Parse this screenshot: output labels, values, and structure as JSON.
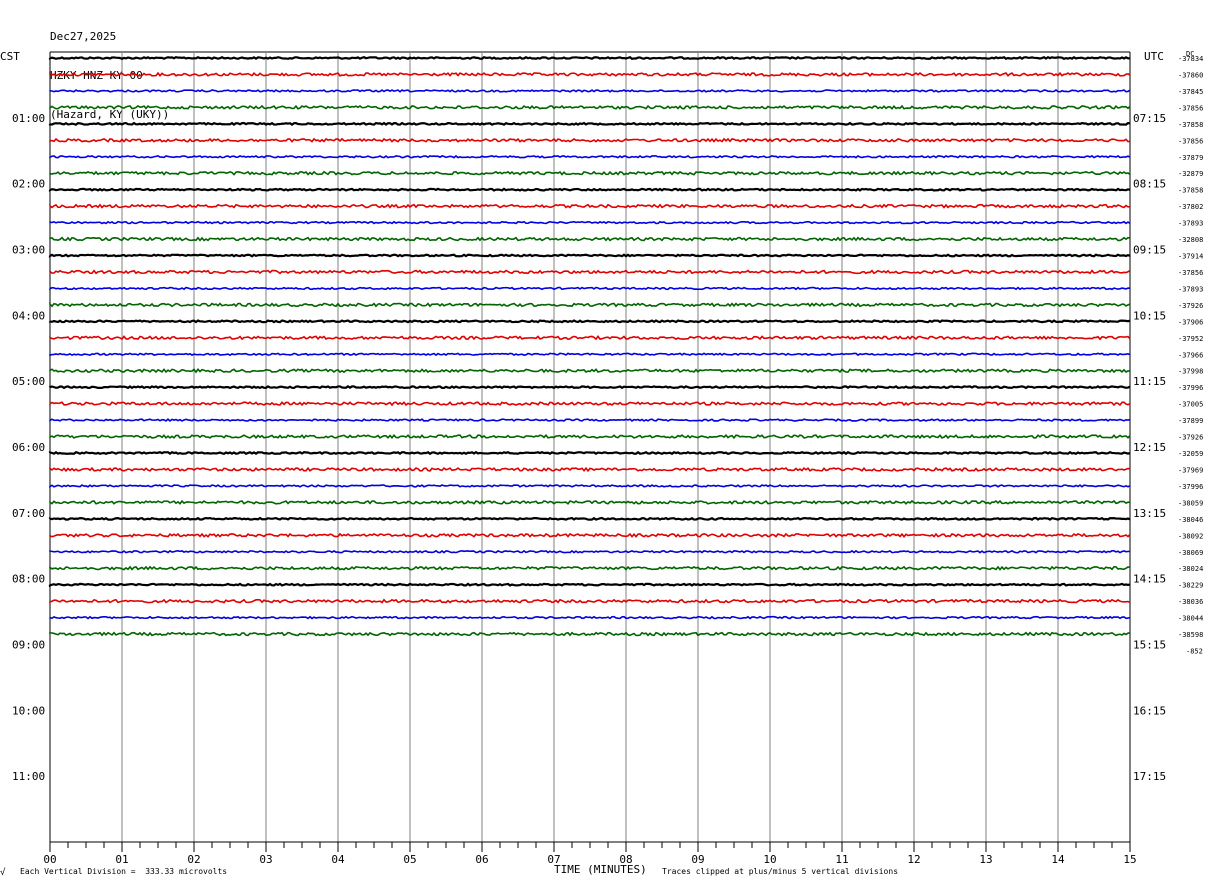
{
  "header": {
    "date": "Dec27,2025",
    "station": "HZKY HNZ KY 00",
    "location": "(Hazard, KY (UKY))"
  },
  "left_zone": "CST",
  "right_zone": "UTC",
  "corner_mark": "DC",
  "footer": {
    "scale_note": "Each Vertical Division =  333.33 microvolts",
    "x_title": "TIME (MINUTES)",
    "clip_note": "Traces clipped at plus/minus 5 vertical divisions",
    "mark": "√"
  },
  "colors": {
    "grid": "#808080",
    "trace_cycle": [
      "#000000",
      "#e00000",
      "#0000e0",
      "#006400"
    ]
  },
  "chart_data": {
    "type": "line",
    "x_ticks": [
      "00",
      "01",
      "02",
      "03",
      "04",
      "05",
      "06",
      "07",
      "08",
      "09",
      "10",
      "11",
      "12",
      "13",
      "14",
      "15"
    ],
    "xlim": [
      0,
      15
    ],
    "left_hours": [
      "01:00",
      "02:00",
      "03:00",
      "04:00",
      "05:00",
      "06:00",
      "07:00",
      "08:00",
      "09:00",
      "10:00",
      "11:00"
    ],
    "right_hours": [
      "07:15",
      "08:15",
      "09:15",
      "10:15",
      "11:15",
      "12:15",
      "13:15",
      "14:15",
      "15:15",
      "16:15",
      "17:15"
    ],
    "traces_per_hour": 4,
    "total_rows": 48,
    "trace_count": 36,
    "trace_labels": [
      "-37834",
      "-37860",
      "-37845",
      "-37856",
      "-37858",
      "-37856",
      "-37879",
      "-32879",
      "-37858",
      "-37802",
      "-37893",
      "-32808",
      "-37914",
      "-37856",
      "-37893",
      "-37926",
      "-37906",
      "-37952",
      "-37966",
      "-37998",
      "-37996",
      "-37005",
      "-37899",
      "-37926",
      "-32059",
      "-37969",
      "-37996",
      "-38059",
      "-38046",
      "-38092",
      "-38069",
      "-38024",
      "-38229",
      "-38036",
      "-38044",
      "-38598"
    ],
    "last_label": "-852"
  }
}
